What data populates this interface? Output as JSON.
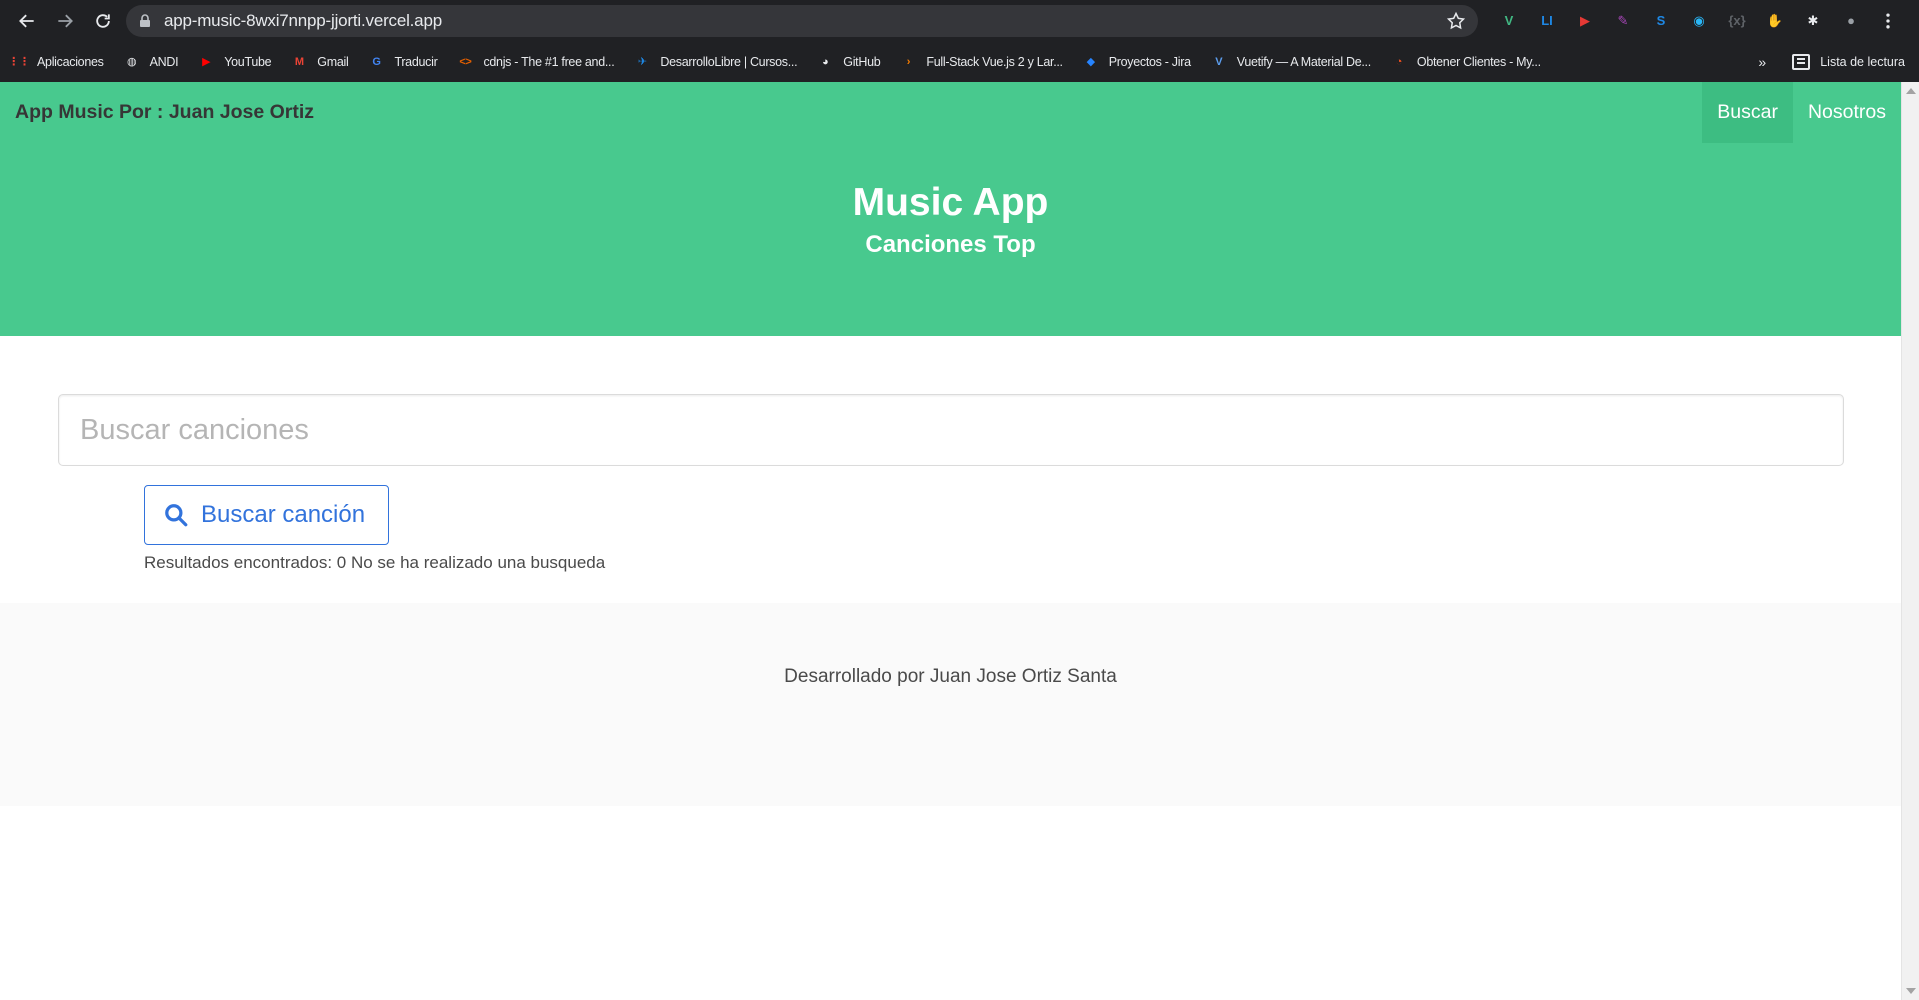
{
  "browser": {
    "url": "app-music-8wxi7nnpp-jjorti.vercel.app",
    "extensions": [
      {
        "icon": "vue-devtools-icon",
        "glyph": "V",
        "color": "#41b883"
      },
      {
        "icon": "linkedin-helper-icon",
        "glyph": "LI",
        "color": "#1e88e5"
      },
      {
        "icon": "player-ext-icon",
        "glyph": "▶",
        "color": "#e53935"
      },
      {
        "icon": "feather-ext-icon",
        "glyph": "✎",
        "color": "#ab47bc"
      },
      {
        "icon": "s-ext-icon",
        "glyph": "S",
        "color": "#1e88e5"
      },
      {
        "icon": "sound-ext-icon",
        "glyph": "◉",
        "color": "#29b6f6"
      },
      {
        "icon": "code-ext-icon",
        "glyph": "{x}",
        "color": "#5f6368"
      },
      {
        "icon": "stop-ext-icon",
        "glyph": "✋",
        "color": "#e53935"
      },
      {
        "icon": "puzzle-icon",
        "glyph": "✱",
        "color": "#e8eaed"
      },
      {
        "icon": "profile-avatar-icon",
        "glyph": "●",
        "color": "#9aa0a6"
      }
    ],
    "bookmarks": [
      {
        "label": "Aplicaciones",
        "icon": "apps-grid-icon",
        "glyph": "⋮⋮",
        "color": "#ea4335"
      },
      {
        "label": "ANDI",
        "icon": "globe-icon",
        "glyph": "◍",
        "color": "#e8eaed"
      },
      {
        "label": "YouTube",
        "icon": "youtube-icon",
        "glyph": "▶",
        "color": "#ff0000"
      },
      {
        "label": "Gmail",
        "icon": "gmail-icon",
        "glyph": "M",
        "color": "#ea4335"
      },
      {
        "label": "Traducir",
        "icon": "translate-icon",
        "glyph": "G",
        "color": "#4285f4"
      },
      {
        "label": "cdnjs - The #1 free and...",
        "icon": "cdnjs-icon",
        "glyph": "<>",
        "color": "#e66000"
      },
      {
        "label": "DesarrolloLibre | Cursos...",
        "icon": "desarrollolibre-icon",
        "glyph": "✈",
        "color": "#1e88e5"
      },
      {
        "label": "GitHub",
        "icon": "github-icon",
        "glyph": "◕",
        "color": "#e8eaed"
      },
      {
        "label": "Full-Stack Vue.js 2 y Lar...",
        "icon": "udemy-icon",
        "glyph": "›",
        "color": "#f57c00"
      },
      {
        "label": "Proyectos - Jira",
        "icon": "jira-icon",
        "glyph": "◆",
        "color": "#2684ff"
      },
      {
        "label": "Vuetify — A Material De...",
        "icon": "vuetify-icon",
        "glyph": "V",
        "color": "#5c9ded"
      },
      {
        "label": "Obtener Clientes - My...",
        "icon": "clients-icon",
        "glyph": "◔",
        "color": "#f4511e"
      }
    ],
    "overflow_label": "»",
    "reading_list_label": "Lista de lectura"
  },
  "navbar": {
    "brand": "App Music Por : Juan Jose Ortiz",
    "links": [
      {
        "label": "Buscar",
        "active": true
      },
      {
        "label": "Nosotros",
        "active": false
      }
    ]
  },
  "hero": {
    "title": "Music App",
    "subtitle": "Canciones Top"
  },
  "search": {
    "placeholder": "Buscar canciones",
    "value": "",
    "button_label": "Buscar canción",
    "results_text": "Resultados encontrados: 0 No se ha realizado una busqueda"
  },
  "footer": {
    "text": "Desarrollado por Juan Jose Ortiz Santa"
  },
  "colors": {
    "primary": "#48c98e",
    "link": "#3273dc",
    "browser_dark": "#202124"
  }
}
